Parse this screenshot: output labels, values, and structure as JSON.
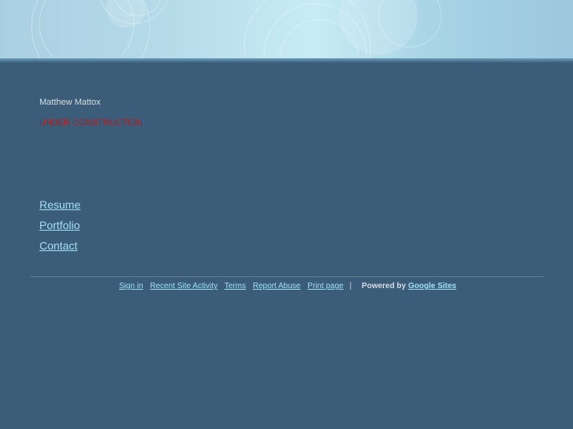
{
  "header": {
    "banner_icon": "decorative-circles"
  },
  "site": {
    "owner_name": "Matthew Mattox",
    "status": "UNDER CONSTRUCTION"
  },
  "nav": {
    "items": [
      {
        "label": "Resume"
      },
      {
        "label": "Portfolio"
      },
      {
        "label": "Contact"
      }
    ]
  },
  "footer": {
    "links": [
      {
        "label": "Sign in"
      },
      {
        "label": "Recent Site Activity"
      },
      {
        "label": "Terms"
      },
      {
        "label": "Report Abuse"
      },
      {
        "label": "Print page"
      }
    ],
    "separator": "|",
    "powered_by": "Powered by",
    "brand": "Google Sites"
  },
  "colors": {
    "background": "#3b5d79",
    "link": "#9fe0f7",
    "status": "#cc1111"
  }
}
